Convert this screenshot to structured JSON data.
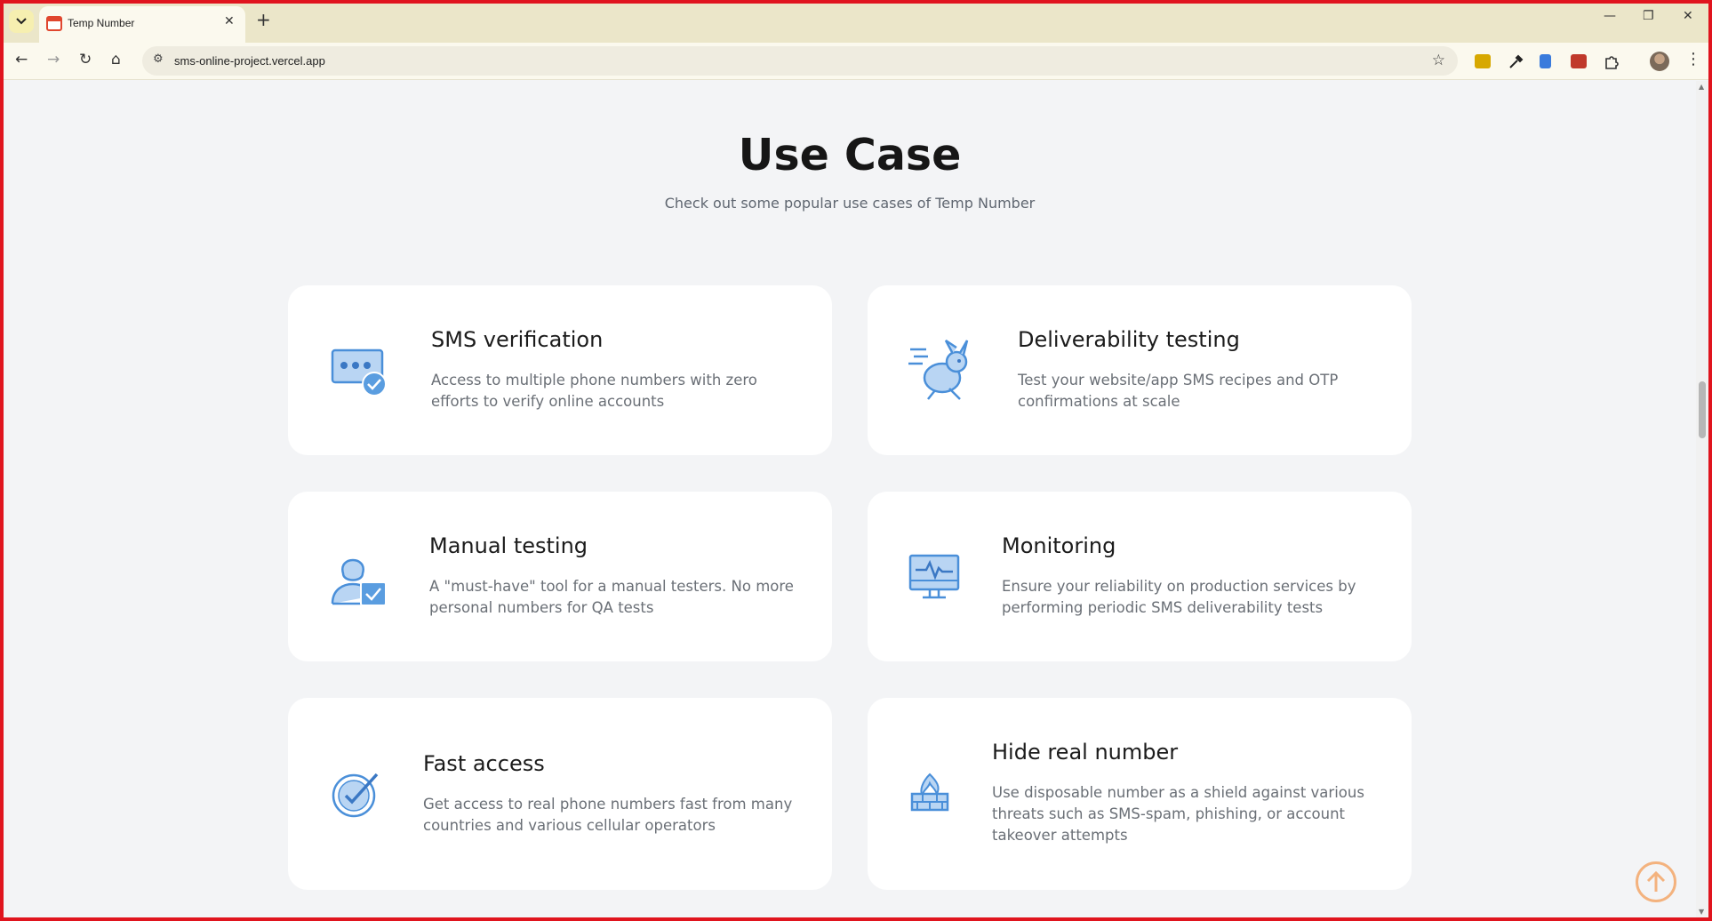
{
  "browser": {
    "tab_title": "Temp Number",
    "url": "sms-online-project.vercel.app",
    "icons": {
      "tab_search": "chevron-down-icon",
      "tab_close": "close-icon",
      "new_tab": "plus-icon",
      "minimize": "minimize-icon",
      "restore": "restore-icon",
      "close_window": "close-icon",
      "back": "back-arrow-icon",
      "forward": "forward-arrow-icon",
      "reload": "reload-icon",
      "home": "home-icon",
      "site_info": "site-info-icon",
      "bookmark": "star-icon",
      "menu": "more-vert-icon"
    }
  },
  "section": {
    "title": "Use Case",
    "subtitle": "Check out some popular use cases of Temp Number"
  },
  "cards": [
    {
      "icon": "sms-chat-check-icon",
      "title": "SMS verification",
      "description": "Access to multiple phone numbers with zero efforts to verify online accounts"
    },
    {
      "icon": "rabbit-icon",
      "title": "Deliverability testing",
      "description": "Test your website/app SMS recipes and OTP confirmations at scale"
    },
    {
      "icon": "tester-person-icon",
      "title": "Manual testing",
      "description": "A \"must-have\" tool for a manual testers. No more personal numbers for QA tests"
    },
    {
      "icon": "monitor-pulse-icon",
      "title": "Monitoring",
      "description": "Ensure your reliability on production services by performing periodic SMS deliverability tests"
    },
    {
      "icon": "check-circle-icon",
      "title": "Fast access",
      "description": "Get access to real phone numbers fast from many countries and various cellular operators"
    },
    {
      "icon": "firewall-icon",
      "title": "Hide real number",
      "description": "Use disposable number as a shield against various threats such as SMS-spam, phishing, or account takeover attempts"
    }
  ],
  "scroll_to_top_icon": "arrow-up-circle-icon",
  "colors": {
    "accent": "#4a8fd9",
    "icon_fill": "#b9d5f3",
    "scroll_top": "#f3b27e"
  }
}
